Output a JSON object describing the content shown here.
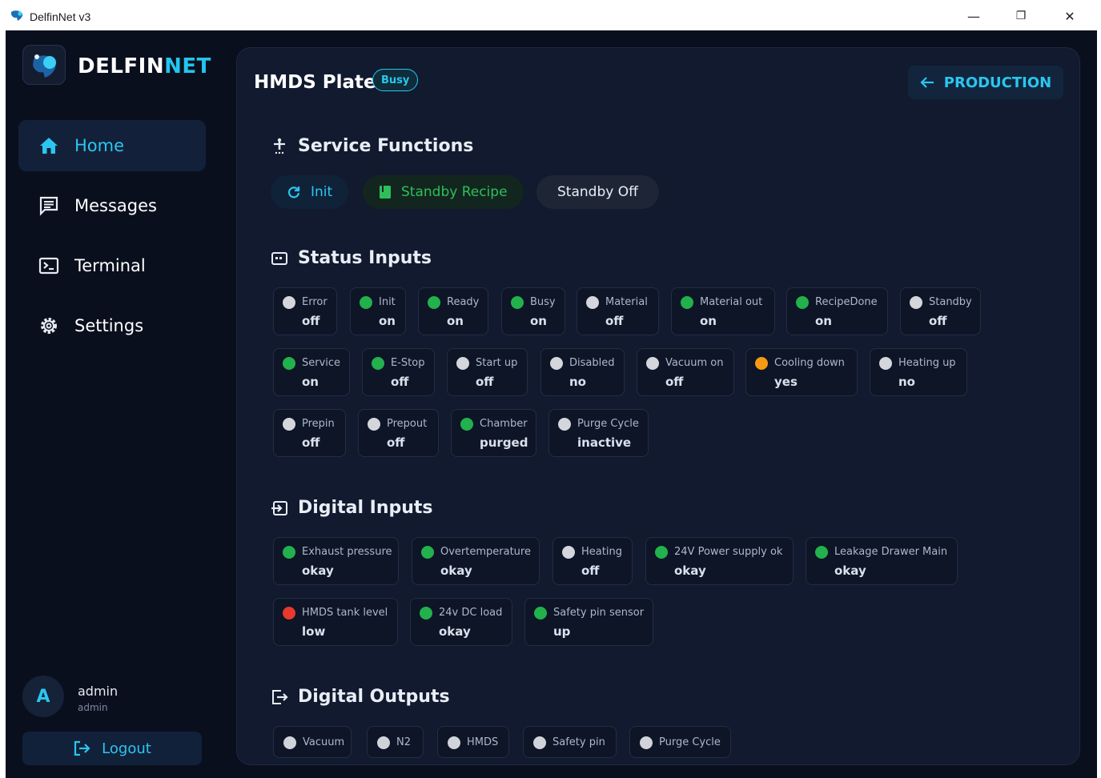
{
  "window": {
    "title": "DelfinNet v3",
    "minimize": "—",
    "restore": "❐",
    "close": "✕"
  },
  "sidebar": {
    "logo": {
      "part1": "DELFIN",
      "part2": "NET"
    },
    "items": [
      {
        "label": "Home",
        "icon": "home-icon",
        "active": true
      },
      {
        "label": "Messages",
        "icon": "message-icon",
        "active": false
      },
      {
        "label": "Terminal",
        "icon": "terminal-icon",
        "active": false
      },
      {
        "label": "Settings",
        "icon": "gear-icon",
        "active": false
      }
    ],
    "user": {
      "initial": "A",
      "name": "admin",
      "role": "admin"
    },
    "logout_label": "Logout"
  },
  "header": {
    "title": "HMDS Plate",
    "badge": "Busy",
    "back_label": "PRODUCTION"
  },
  "service_functions": {
    "title": "Service Functions",
    "buttons": [
      {
        "label": "Init",
        "icon": "refresh-icon"
      },
      {
        "label": "Standby Recipe",
        "icon": "book-icon"
      },
      {
        "label": "Standby Off",
        "icon": ""
      }
    ]
  },
  "status_inputs": {
    "title": "Status Inputs",
    "items": [
      {
        "label": "Error",
        "value": "off",
        "color": "#d4d6db"
      },
      {
        "label": "Init",
        "value": "on",
        "color": "#22b14c"
      },
      {
        "label": "Ready",
        "value": "on",
        "color": "#22b14c"
      },
      {
        "label": "Busy",
        "value": "on",
        "color": "#22b14c"
      },
      {
        "label": "Material",
        "value": "off",
        "color": "#d4d6db"
      },
      {
        "label": "Material out",
        "value": "on",
        "color": "#22b14c"
      },
      {
        "label": "RecipeDone",
        "value": "on",
        "color": "#22b14c"
      },
      {
        "label": "Standby",
        "value": "off",
        "color": "#d4d6db"
      },
      {
        "label": "Service",
        "value": "on",
        "color": "#22b14c"
      },
      {
        "label": "E-Stop",
        "value": "off",
        "color": "#22b14c"
      },
      {
        "label": "Start up",
        "value": "off",
        "color": "#d4d6db"
      },
      {
        "label": "Disabled",
        "value": "no",
        "color": "#d4d6db"
      },
      {
        "label": "Vacuum on",
        "value": "off",
        "color": "#d4d6db"
      },
      {
        "label": "Cooling down",
        "value": "yes",
        "color": "#f59a12"
      },
      {
        "label": "Heating up",
        "value": "no",
        "color": "#d4d6db"
      },
      {
        "label": "Prepin",
        "value": "off",
        "color": "#d4d6db"
      },
      {
        "label": "Prepout",
        "value": "off",
        "color": "#d4d6db"
      },
      {
        "label": "Chamber",
        "value": "purged",
        "color": "#22b14c"
      },
      {
        "label": "Purge Cycle",
        "value": "inactive",
        "color": "#d4d6db"
      }
    ]
  },
  "digital_inputs": {
    "title": "Digital Inputs",
    "items": [
      {
        "label": "Exhaust pressure",
        "value": "okay",
        "color": "#22b14c"
      },
      {
        "label": "Overtemperature",
        "value": "okay",
        "color": "#22b14c"
      },
      {
        "label": "Heating",
        "value": "off",
        "color": "#d4d6db"
      },
      {
        "label": "24V Power supply ok",
        "value": "okay",
        "color": "#22b14c"
      },
      {
        "label": "Leakage Drawer Main",
        "value": "okay",
        "color": "#22b14c"
      },
      {
        "label": "HMDS tank level",
        "value": "low",
        "color": "#e8392c"
      },
      {
        "label": "24v DC load",
        "value": "okay",
        "color": "#22b14c"
      },
      {
        "label": "Safety pin sensor",
        "value": "up",
        "color": "#22b14c"
      }
    ]
  },
  "digital_outputs": {
    "title": "Digital Outputs",
    "items": [
      {
        "label": "Vacuum"
      },
      {
        "label": "N2"
      },
      {
        "label": "HMDS"
      },
      {
        "label": "Safety pin"
      },
      {
        "label": "Purge Cycle"
      }
    ]
  }
}
